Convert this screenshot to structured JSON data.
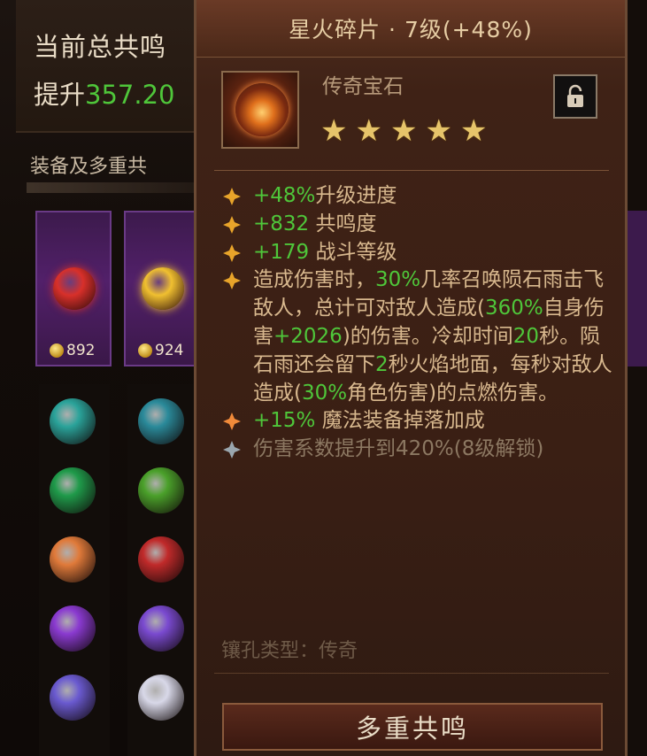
{
  "background": {
    "title": "当前总共鸣",
    "boost_prefix": "提升",
    "boost_value": "357.20",
    "section_label": "装备及多重共",
    "slots": [
      {
        "rank": "892",
        "gem_color": "#d8302a"
      },
      {
        "rank": "924",
        "gem_color": "#f0c030"
      }
    ],
    "column_gems": [
      [
        "#2aa39a",
        "#1f9a4a",
        "#e07a3a",
        "#8a3ad0",
        "#6a5ad0"
      ],
      [
        "#2a8a9a",
        "#4aa02a",
        "#c02a2a",
        "#7a4ad0",
        "#d8d8e8"
      ]
    ]
  },
  "tooltip": {
    "title": "星火碎片 · 7级(+48%)",
    "item_type": "传奇宝石",
    "stars": 5,
    "lock_icon": "lock-icon",
    "effects": [
      {
        "parts": [
          {
            "t": "+48%",
            "g": true
          },
          {
            "t": "升级进度",
            "g": false
          }
        ]
      },
      {
        "parts": [
          {
            "t": "+832",
            "g": true
          },
          {
            "t": " 共鸣度",
            "g": false
          }
        ]
      },
      {
        "parts": [
          {
            "t": "+179",
            "g": true
          },
          {
            "t": " 战斗等级",
            "g": false
          }
        ]
      },
      {
        "parts": [
          {
            "t": "造成伤害时，",
            "g": false
          },
          {
            "t": "30%",
            "g": true
          },
          {
            "t": "几率召唤陨石雨击飞敌人，总计可对敌人造成(",
            "g": false
          },
          {
            "t": "360%",
            "g": true
          },
          {
            "t": "自身伤害",
            "g": false
          },
          {
            "t": "+2026",
            "g": true
          },
          {
            "t": ")的伤害。冷却时间",
            "g": false
          },
          {
            "t": "20",
            "g": true
          },
          {
            "t": "秒。陨石雨还会留下",
            "g": false
          },
          {
            "t": "2",
            "g": true
          },
          {
            "t": "秒火焰地面，每秒对敌人造成(",
            "g": false
          },
          {
            "t": "30%",
            "g": true
          },
          {
            "t": "角色伤害)的点燃伤害。",
            "g": false
          }
        ]
      },
      {
        "parts": [
          {
            "t": "+15%",
            "g": true
          },
          {
            "t": " 魔法装备掉落加成",
            "g": false
          }
        ]
      },
      {
        "parts": [
          {
            "t": "伤害系数提升到420%(8级解锁)",
            "g": false
          }
        ],
        "locked": true
      }
    ],
    "socket_label": "镶孔类型：传奇",
    "button_label": "多重共鸣"
  }
}
